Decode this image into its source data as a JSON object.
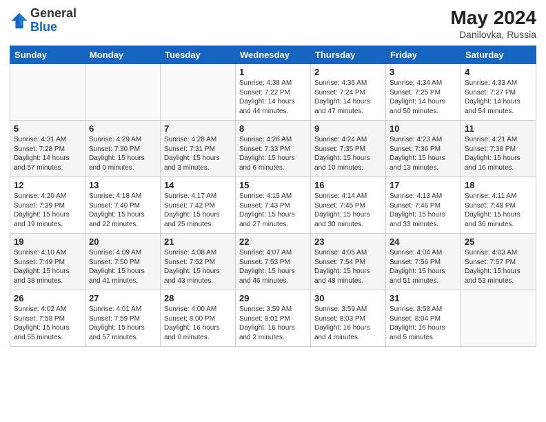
{
  "header": {
    "logo_general": "General",
    "logo_blue": "Blue",
    "month_year": "May 2024",
    "location": "Danilovka, Russia"
  },
  "weekdays": [
    "Sunday",
    "Monday",
    "Tuesday",
    "Wednesday",
    "Thursday",
    "Friday",
    "Saturday"
  ],
  "weeks": [
    [
      {
        "day": "",
        "info": ""
      },
      {
        "day": "",
        "info": ""
      },
      {
        "day": "",
        "info": ""
      },
      {
        "day": "1",
        "info": "Sunrise: 4:38 AM\nSunset: 7:22 PM\nDaylight: 14 hours\nand 44 minutes."
      },
      {
        "day": "2",
        "info": "Sunrise: 4:36 AM\nSunset: 7:24 PM\nDaylight: 14 hours\nand 47 minutes."
      },
      {
        "day": "3",
        "info": "Sunrise: 4:34 AM\nSunset: 7:25 PM\nDaylight: 14 hours\nand 50 minutes."
      },
      {
        "day": "4",
        "info": "Sunrise: 4:33 AM\nSunset: 7:27 PM\nDaylight: 14 hours\nand 54 minutes."
      }
    ],
    [
      {
        "day": "5",
        "info": "Sunrise: 4:31 AM\nSunset: 7:28 PM\nDaylight: 14 hours\nand 57 minutes."
      },
      {
        "day": "6",
        "info": "Sunrise: 4:29 AM\nSunset: 7:30 PM\nDaylight: 15 hours\nand 0 minutes."
      },
      {
        "day": "7",
        "info": "Sunrise: 4:28 AM\nSunset: 7:31 PM\nDaylight: 15 hours\nand 3 minutes."
      },
      {
        "day": "8",
        "info": "Sunrise: 4:26 AM\nSunset: 7:33 PM\nDaylight: 15 hours\nand 6 minutes."
      },
      {
        "day": "9",
        "info": "Sunrise: 4:24 AM\nSunset: 7:35 PM\nDaylight: 15 hours\nand 10 minutes."
      },
      {
        "day": "10",
        "info": "Sunrise: 4:23 AM\nSunset: 7:36 PM\nDaylight: 15 hours\nand 13 minutes."
      },
      {
        "day": "11",
        "info": "Sunrise: 4:21 AM\nSunset: 7:38 PM\nDaylight: 15 hours\nand 16 minutes."
      }
    ],
    [
      {
        "day": "12",
        "info": "Sunrise: 4:20 AM\nSunset: 7:39 PM\nDaylight: 15 hours\nand 19 minutes."
      },
      {
        "day": "13",
        "info": "Sunrise: 4:18 AM\nSunset: 7:40 PM\nDaylight: 15 hours\nand 22 minutes."
      },
      {
        "day": "14",
        "info": "Sunrise: 4:17 AM\nSunset: 7:42 PM\nDaylight: 15 hours\nand 25 minutes."
      },
      {
        "day": "15",
        "info": "Sunrise: 4:15 AM\nSunset: 7:43 PM\nDaylight: 15 hours\nand 27 minutes."
      },
      {
        "day": "16",
        "info": "Sunrise: 4:14 AM\nSunset: 7:45 PM\nDaylight: 15 hours\nand 30 minutes."
      },
      {
        "day": "17",
        "info": "Sunrise: 4:13 AM\nSunset: 7:46 PM\nDaylight: 15 hours\nand 33 minutes."
      },
      {
        "day": "18",
        "info": "Sunrise: 4:11 AM\nSunset: 7:48 PM\nDaylight: 15 hours\nand 36 minutes."
      }
    ],
    [
      {
        "day": "19",
        "info": "Sunrise: 4:10 AM\nSunset: 7:49 PM\nDaylight: 15 hours\nand 38 minutes."
      },
      {
        "day": "20",
        "info": "Sunrise: 4:09 AM\nSunset: 7:50 PM\nDaylight: 15 hours\nand 41 minutes."
      },
      {
        "day": "21",
        "info": "Sunrise: 4:08 AM\nSunset: 7:52 PM\nDaylight: 15 hours\nand 43 minutes."
      },
      {
        "day": "22",
        "info": "Sunrise: 4:07 AM\nSunset: 7:53 PM\nDaylight: 15 hours\nand 46 minutes."
      },
      {
        "day": "23",
        "info": "Sunrise: 4:05 AM\nSunset: 7:54 PM\nDaylight: 15 hours\nand 48 minutes."
      },
      {
        "day": "24",
        "info": "Sunrise: 4:04 AM\nSunset: 7:56 PM\nDaylight: 15 hours\nand 51 minutes."
      },
      {
        "day": "25",
        "info": "Sunrise: 4:03 AM\nSunset: 7:57 PM\nDaylight: 15 hours\nand 53 minutes."
      }
    ],
    [
      {
        "day": "26",
        "info": "Sunrise: 4:02 AM\nSunset: 7:58 PM\nDaylight: 15 hours\nand 55 minutes."
      },
      {
        "day": "27",
        "info": "Sunrise: 4:01 AM\nSunset: 7:59 PM\nDaylight: 15 hours\nand 57 minutes."
      },
      {
        "day": "28",
        "info": "Sunrise: 4:00 AM\nSunset: 8:00 PM\nDaylight: 16 hours\nand 0 minutes."
      },
      {
        "day": "29",
        "info": "Sunrise: 3:59 AM\nSunset: 8:01 PM\nDaylight: 16 hours\nand 2 minutes."
      },
      {
        "day": "30",
        "info": "Sunrise: 3:59 AM\nSunset: 8:03 PM\nDaylight: 16 hours\nand 4 minutes."
      },
      {
        "day": "31",
        "info": "Sunrise: 3:58 AM\nSunset: 8:04 PM\nDaylight: 16 hours\nand 5 minutes."
      },
      {
        "day": "",
        "info": ""
      }
    ]
  ]
}
